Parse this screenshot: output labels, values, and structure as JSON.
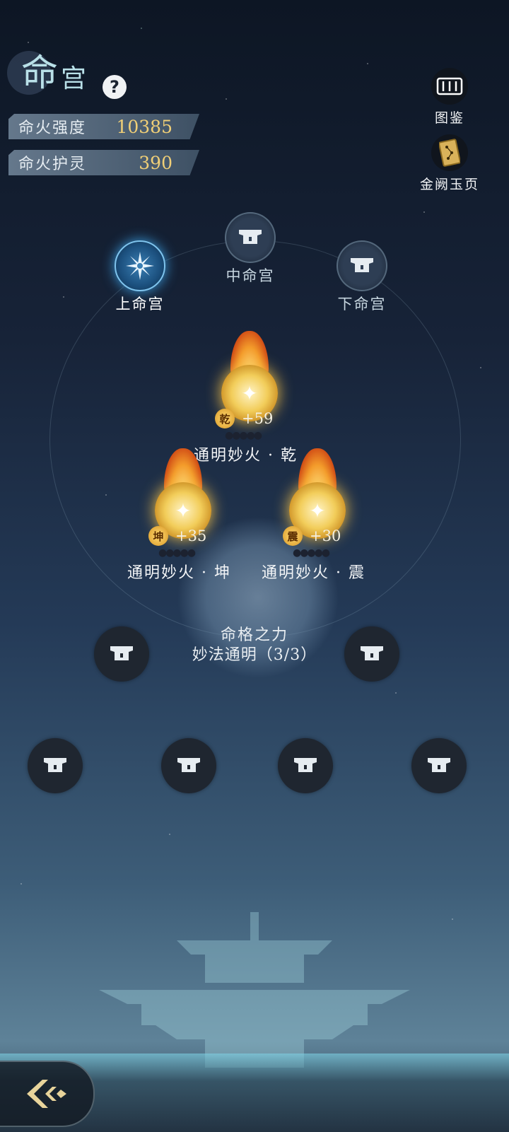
{
  "header": {
    "title_big": "命",
    "title_small": "宫",
    "help_label": "?"
  },
  "stats": [
    {
      "label": "命火强度",
      "value": "10385"
    },
    {
      "label": "命火护灵",
      "value": "390"
    }
  ],
  "side_buttons": [
    {
      "label": "图鉴",
      "icon": "scroll-icon"
    },
    {
      "label": "金阙玉页",
      "icon": "star-map-card-icon"
    }
  ],
  "palaces": [
    {
      "label": "上命宫",
      "active": true,
      "icon": "snowflake-star-icon"
    },
    {
      "label": "中命宫",
      "active": false,
      "icon": "lock-icon"
    },
    {
      "label": "下命宫",
      "active": false,
      "icon": "lock-icon"
    }
  ],
  "fires": [
    {
      "tag": "乾",
      "bonus": "+59",
      "name": "通明妙火 · 乾",
      "pips": "●●●●●"
    },
    {
      "tag": "坤",
      "bonus": "+35",
      "name": "通明妙火 · 坤",
      "pips": "●●●●●"
    },
    {
      "tag": "震",
      "bonus": "+30",
      "name": "通明妙火 · 震",
      "pips": "●●●●●"
    }
  ],
  "destiny": {
    "title": "命格之力",
    "value": "妙法通明（3/3）"
  },
  "locked_slots_count": 6,
  "colors": {
    "accent_gold": "#f0cf77",
    "active_blue": "#3a9de0",
    "title_teal": "#b9e0e8"
  }
}
